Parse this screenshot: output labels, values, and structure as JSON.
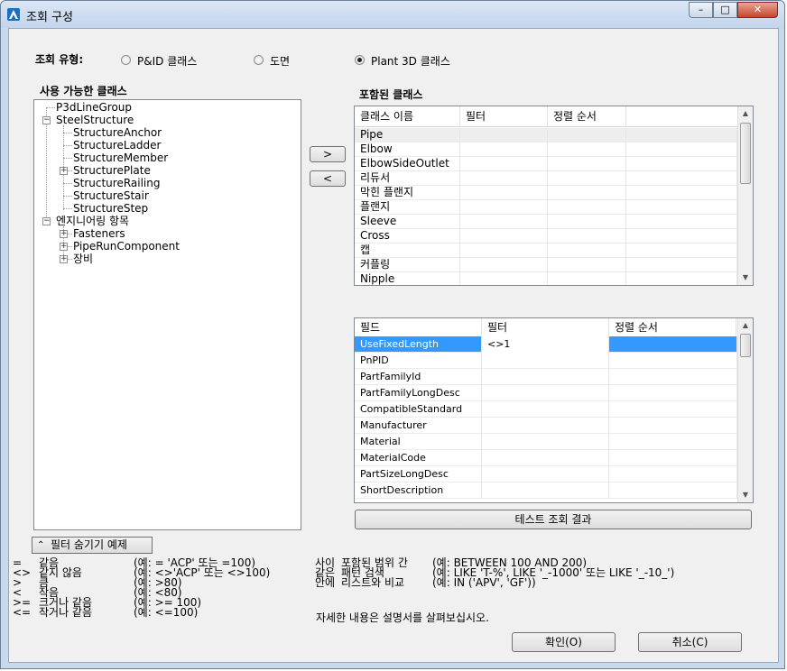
{
  "window": {
    "title": "조회 구성",
    "buttons": {
      "minimize": "–",
      "maximize": "□",
      "close": "✕"
    }
  },
  "query_type": {
    "label": "조회 유형:",
    "options": [
      "P&ID 클래스",
      "도면",
      "Plant 3D 클래스"
    ],
    "selected": "Plant 3D 클래스"
  },
  "available": {
    "label": "사용 가능한 클래스",
    "tree": [
      "P3dLineGroup",
      "SteelStructure",
      "StructureAnchor",
      "StructureLadder",
      "StructureMember",
      "StructurePlate",
      "StructureRailing",
      "StructureStair",
      "StructureStep",
      "엔지니어링 항목",
      "Fasteners",
      "PipeRunComponent",
      "장비"
    ]
  },
  "move_buttons": {
    "add": ">",
    "remove": "<"
  },
  "included": {
    "label": "포함된 클래스",
    "columns": [
      "클래스 이름",
      "필터",
      "정렬 순서"
    ],
    "rows": [
      "Pipe",
      "Elbow",
      "ElbowSideOutlet",
      "리듀서",
      "막힌 플랜지",
      "플랜지",
      "Sleeve",
      "Cross",
      "캡",
      "커플링",
      "Nipple"
    ]
  },
  "fields": {
    "columns": [
      "필드",
      "필터",
      "정렬 순서"
    ],
    "rows": [
      {
        "name": "UseFixedLength",
        "filter": "<>1"
      },
      {
        "name": "PnPID",
        "filter": ""
      },
      {
        "name": "PartFamilyId",
        "filter": ""
      },
      {
        "name": "PartFamilyLongDesc",
        "filter": ""
      },
      {
        "name": "CompatibleStandard",
        "filter": ""
      },
      {
        "name": "Manufacturer",
        "filter": ""
      },
      {
        "name": "Material",
        "filter": ""
      },
      {
        "name": "MaterialCode",
        "filter": ""
      },
      {
        "name": "PartSizeLongDesc",
        "filter": ""
      },
      {
        "name": "ShortDescription",
        "filter": ""
      }
    ],
    "selected_row": "UseFixedLength",
    "selected_color": "#3399ff"
  },
  "test_button": "테스트 조회 결과",
  "hide_filter_button": "필터 숨기기 예제",
  "help_ops": [
    {
      "op": "=",
      "name": "같음",
      "example": "(예: = 'ACP' 또는 =100)"
    },
    {
      "op": "<>",
      "name": "같지 않음",
      "example": "(예: <>'ACP' 또는 <>100)"
    },
    {
      "op": ">",
      "name": "큼",
      "example": "(예: >80)"
    },
    {
      "op": "<",
      "name": "작음",
      "example": "(예: <80)"
    },
    {
      "op": ">=",
      "name": "크거나 같음",
      "example": "(예: >= 100)"
    },
    {
      "op": "<=",
      "name": "작거나 같음",
      "example": "(예: <=100)"
    }
  ],
  "help_ops2": [
    {
      "op": "사이",
      "name": "포함된 범위 간",
      "example": "(예: BETWEEN 100 AND 200)"
    },
    {
      "op": "같은",
      "name": "패턴 검색",
      "example": "(예: LIKE 'T-%', LIKE '_-1000' 또는 LIKE '_-10_')"
    },
    {
      "op": "안에",
      "name": "리스트와 비교",
      "example": "(예: IN ('APV', 'GF'))"
    }
  ],
  "help_note": "자세한 내용은 설명서를 살펴보십시오.",
  "ok_button": "확인(O)",
  "cancel_button": "취소(C)"
}
